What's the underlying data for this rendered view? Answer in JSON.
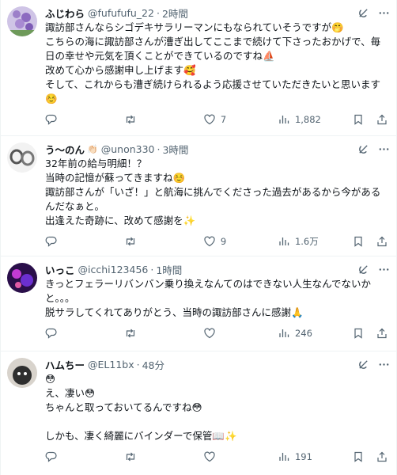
{
  "tweets": [
    {
      "name": "ふじわら",
      "handle": "@fufufufu_22",
      "time": "2時間",
      "lines": [
        "諏訪部さんならシゴデキサラリーマンにもなられていそうですが🤭",
        "こちらの海に諏訪部さんが漕ぎ出してここまで続けて下さったおかげで、毎",
        "日の幸せや元気を頂くことができているのですね⛵",
        "改めて心から感謝申し上げます🥰",
        "そして、これからも漕ぎ続けられるよう応援させていただきたいと思います",
        "☺️"
      ],
      "reply_count": "",
      "retweet_count": "",
      "like_count": "7",
      "view_count": "1,882",
      "avatar_color": "#b9a9d8"
    },
    {
      "name": "う〜のん",
      "badge": "👏🏻",
      "handle": "@unon330",
      "time": "3時間",
      "lines": [
        "32年前の給与明細！？",
        "当時の記憶が蘇ってきますね☺️",
        "諏訪部さんが「いざ！」と航海に挑んでくださった過去があるから今があるんだなぁと。",
        "出逢えた奇跡に、改めて感謝を✨"
      ],
      "reply_count": "",
      "retweet_count": "",
      "like_count": "9",
      "view_count": "1.6万",
      "avatar_color": "#d9d9d9"
    },
    {
      "name": "いっこ",
      "handle": "@icchi123456",
      "time": "1時間",
      "lines": [
        "きっとフェラーリバンバン乗り換えなんてのはできない人生なんでないかと。。。",
        "脱サラしてくれてありがとう、当時の諏訪部さんに感謝🙏"
      ],
      "reply_count": "",
      "retweet_count": "",
      "like_count": "",
      "view_count": "246",
      "avatar_color": "#6a2aa8"
    },
    {
      "name": "ハムちー",
      "handle": "@EL11bx",
      "time": "48分",
      "lines": [
        "😳",
        "え、凄い😳",
        "ちゃんと取っておいてるんですね😳",
        "",
        "しかも、凄く綺麗にバインダーで保管📖✨"
      ],
      "reply_count": "",
      "retweet_count": "",
      "like_count": "",
      "view_count": "191",
      "avatar_color": "#3a3a3a"
    }
  ],
  "ui": {
    "dot": "·",
    "grok_icon": "grok-icon",
    "more_icon": "more-icon"
  }
}
